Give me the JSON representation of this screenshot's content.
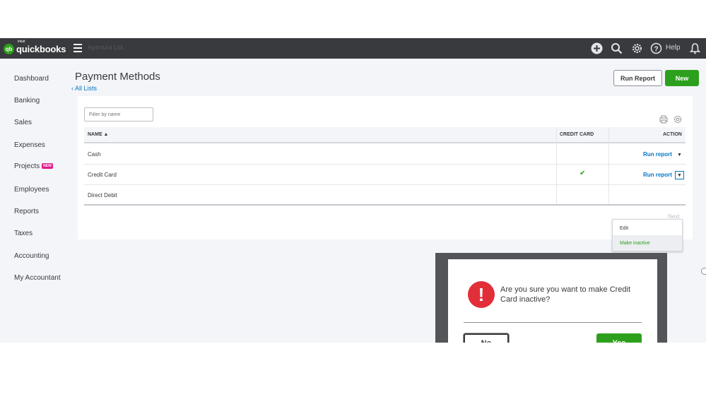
{
  "topbar": {
    "logo_text": "quickbooks",
    "logo_intuit": "intuit",
    "logo_mark": "qb",
    "company_name": "Apertura Ltd.",
    "help_label": "Help",
    "icons": [
      "plus-circle-icon",
      "search-icon",
      "gear-icon",
      "help-icon",
      "bell-icon"
    ]
  },
  "sidebar": {
    "items": [
      {
        "label": "Dashboard"
      },
      {
        "label": "Banking"
      },
      {
        "label": "Sales"
      },
      {
        "label": "Expenses"
      },
      {
        "label": "Projects",
        "badge": "NEW"
      },
      {
        "label": "Employees"
      },
      {
        "label": "Reports"
      },
      {
        "label": "Taxes"
      },
      {
        "label": "Accounting"
      },
      {
        "label": "My Accountant"
      }
    ]
  },
  "header": {
    "title": "Payment Methods",
    "back_link": "All Lists",
    "run_report": "Run Report",
    "new": "New"
  },
  "table": {
    "filter_placeholder": "Filter by name",
    "columns": {
      "name": "NAME ▲",
      "credit_card": "CREDIT CARD",
      "action": "ACTION"
    },
    "rows": [
      {
        "name": "Cash",
        "credit_card": "",
        "action": "Run report"
      },
      {
        "name": "Credit Card",
        "credit_card": "✔",
        "action": "Run report"
      },
      {
        "name": "Direct Debit",
        "credit_card": "",
        "action": ""
      }
    ],
    "pager_next": "Next"
  },
  "menu": {
    "items": [
      "Edit",
      "Make inactive"
    ]
  },
  "dialog": {
    "icon": "!",
    "message": "Are you sure you want to make Credit Card inactive?",
    "no": "No",
    "yes": "Yes"
  },
  "colors": {
    "topbar": "#393a3d",
    "brand_green": "#2ca01c",
    "link_blue": "#0077c5",
    "alert_red": "#e22e38",
    "new_badge": "#e21b8b"
  }
}
